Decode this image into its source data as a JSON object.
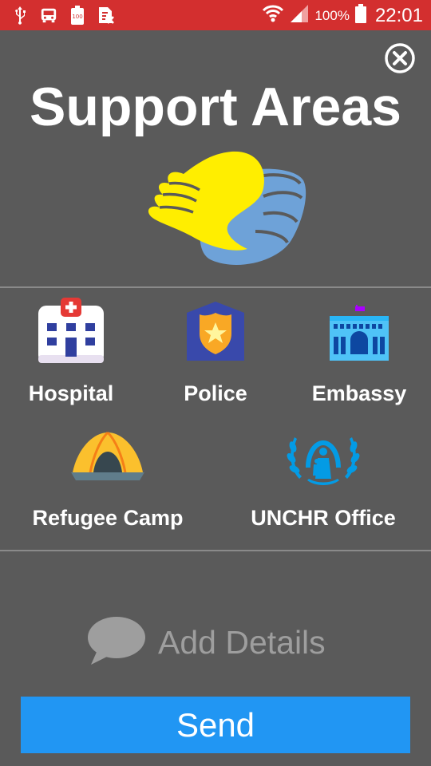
{
  "status_bar": {
    "icons": [
      "usb-icon",
      "bus-icon",
      "battery-100-notification-icon",
      "sim-icon"
    ],
    "battery_percent": "100%",
    "time": "22:01"
  },
  "header": {
    "title": "Support Areas",
    "close_icon": "close-icon"
  },
  "support_areas": [
    {
      "label": "Hospital",
      "icon": "hospital-icon"
    },
    {
      "label": "Police",
      "icon": "police-badge-icon"
    },
    {
      "label": "Embassy",
      "icon": "embassy-building-icon"
    },
    {
      "label": "Refugee Camp",
      "icon": "tent-icon"
    },
    {
      "label": "UNCHR Office",
      "icon": "unhcr-logo-icon"
    }
  ],
  "details": {
    "placeholder": "Add Details",
    "icon": "speech-bubble-icon"
  },
  "actions": {
    "send_label": "Send"
  },
  "colors": {
    "status_bar": "#d32f2f",
    "background": "#5a5a5a",
    "accent": "#2196f3",
    "logo_yellow": "#ffee00",
    "logo_blue": "#6ea2d8"
  }
}
